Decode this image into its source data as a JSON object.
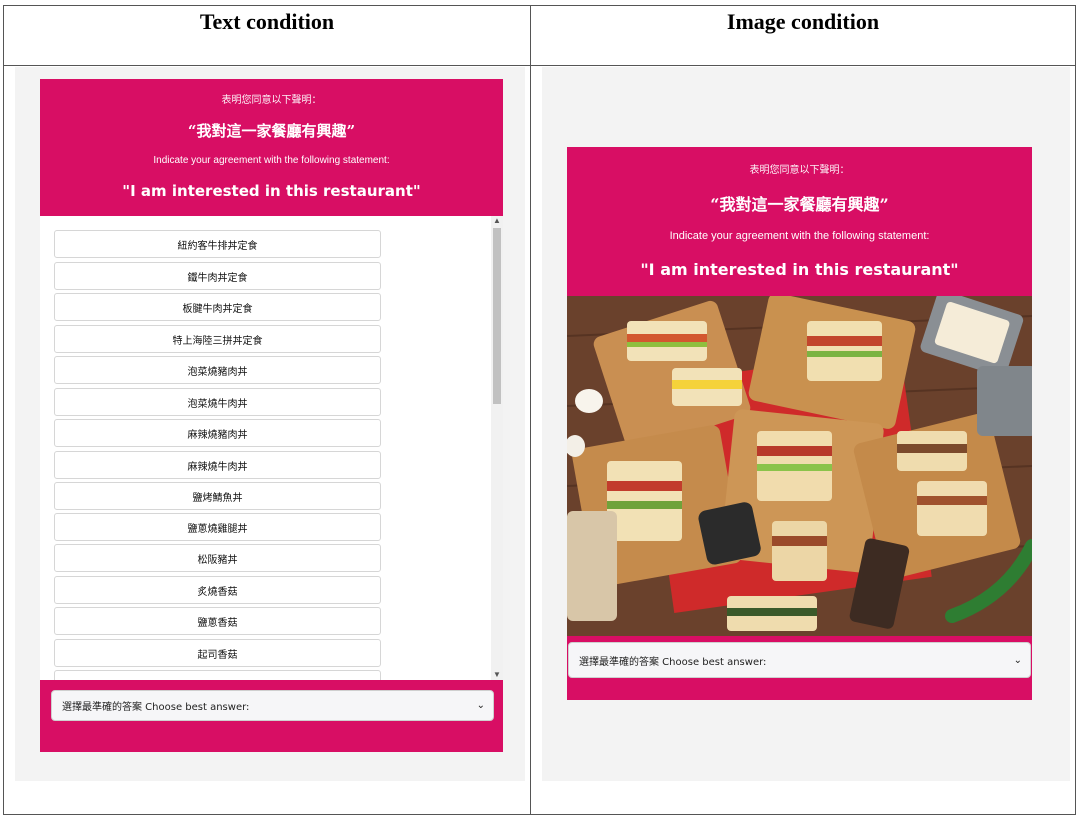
{
  "columns": {
    "text_title": "Text condition",
    "image_title": "Image condition"
  },
  "header": {
    "zh_prompt": "表明您同意以下聲明：",
    "zh_statement": "“我對這一家餐廳有興趣”",
    "en_prompt": "Indicate your agreement with the following statement:",
    "en_statement": "\"I am interested in this restaurant\""
  },
  "menu_items": [
    "紐約客牛排丼定食",
    "鐵牛肉丼定食",
    "板腱牛肉丼定食",
    "特上海陸三拼丼定食",
    "泡菜燒豬肉丼",
    "泡菜燒牛肉丼",
    "麻辣燒豬肉丼",
    "麻辣燒牛肉丼",
    "鹽烤鯖魚丼",
    "鹽蔥燒雞腿丼",
    "松阪豬丼",
    "炙燒香菇",
    "鹽蔥香菇",
    "起司香菇"
  ],
  "select": {
    "placeholder": "選擇最準確的答案 Choose best answer:"
  },
  "colors": {
    "accent": "#d80e64",
    "panel": "#f3f3f3"
  },
  "icons": {
    "dropdown": "chevron-down-icon",
    "scroll_up": "scroll-up-arrow-icon",
    "scroll_down": "scroll-down-arrow-icon"
  }
}
